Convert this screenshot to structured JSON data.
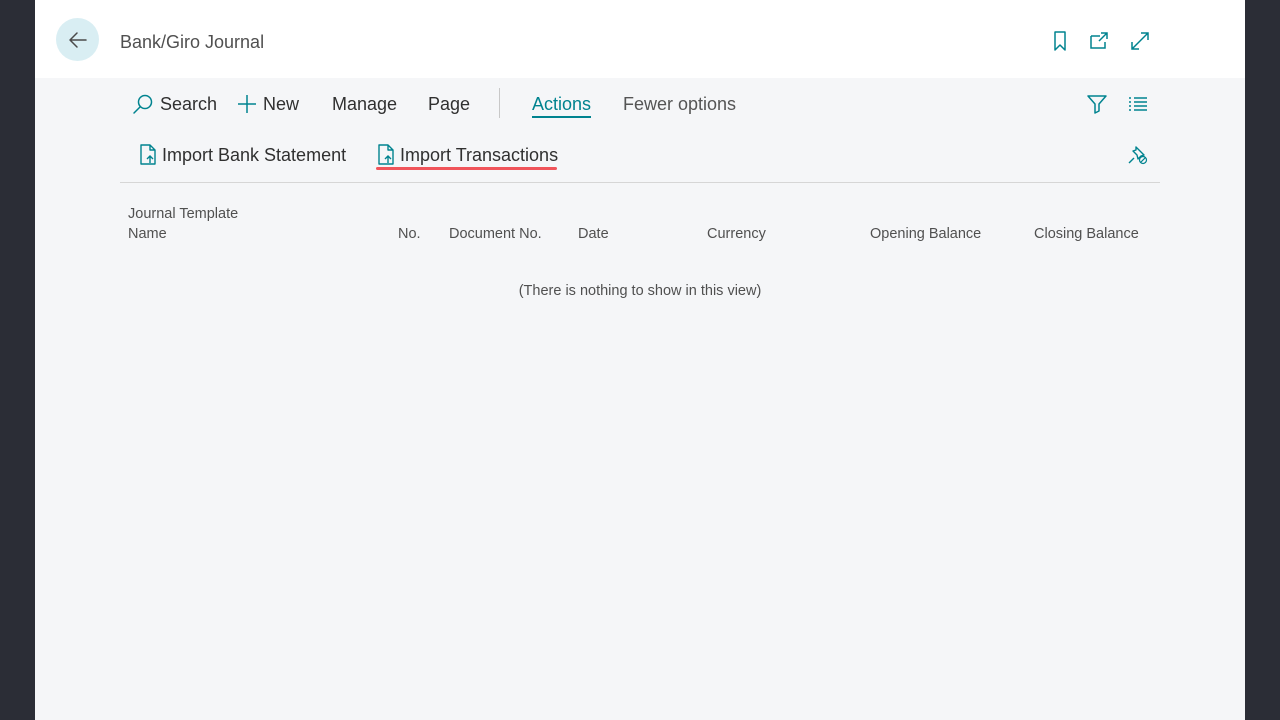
{
  "header": {
    "title": "Bank/Giro Journal",
    "icons": [
      "back-arrow-icon",
      "bookmark-icon",
      "open-in-new-window-icon",
      "expand-icon"
    ]
  },
  "toolbar": {
    "search_label": "Search",
    "new_label": "New",
    "manage_label": "Manage",
    "page_label": "Page",
    "actions_label": "Actions",
    "fewer_options_label": "Fewer options"
  },
  "actions": {
    "import_bank_statement_label": "Import Bank Statement",
    "import_transactions_label": "Import Transactions"
  },
  "table": {
    "columns": [
      {
        "line1": "Journal Template",
        "line2": "Name"
      },
      {
        "line1": "",
        "line2": "No."
      },
      {
        "line1": "",
        "line2": "Document No."
      },
      {
        "line1": "",
        "line2": "Date"
      },
      {
        "line1": "",
        "line2": "Currency"
      },
      {
        "line1": "",
        "line2": "Opening Balance"
      },
      {
        "line1": "",
        "line2": "Closing Balance"
      }
    ],
    "empty_message": "(There is nothing to show in this view)"
  },
  "colors": {
    "accent": "#00838f",
    "highlight": "#f0545a",
    "back_button_bg": "#d9eef3"
  }
}
